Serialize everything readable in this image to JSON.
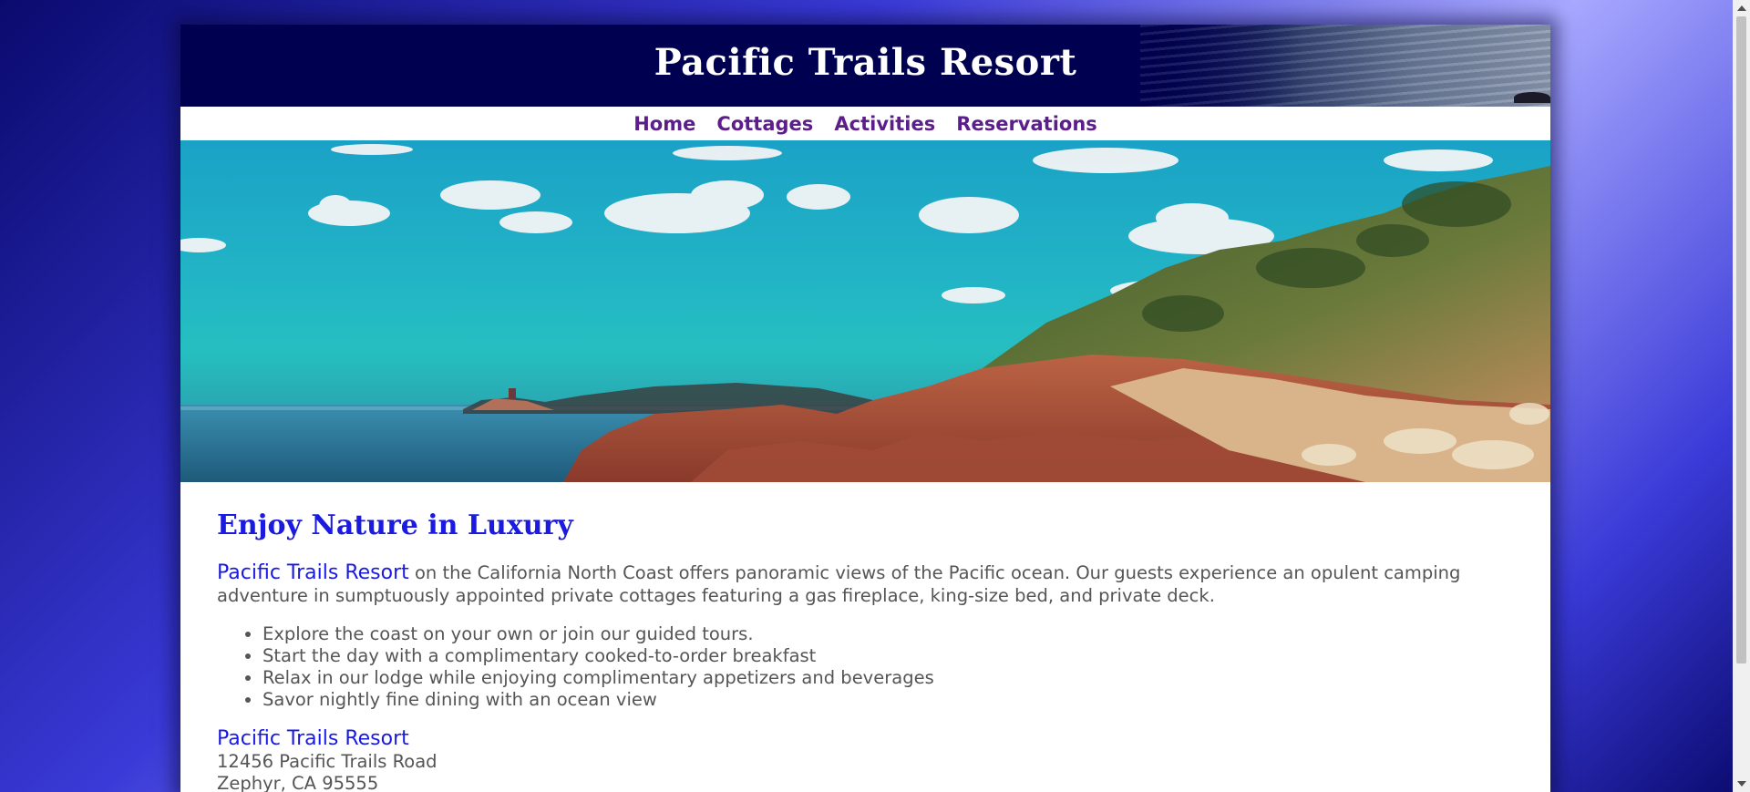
{
  "site": {
    "title": "Pacific Trails Resort"
  },
  "nav": {
    "items": [
      {
        "label": "Home"
      },
      {
        "label": "Cottages"
      },
      {
        "label": "Activities"
      },
      {
        "label": "Reservations"
      }
    ]
  },
  "main": {
    "heading": "Enjoy Nature in Luxury",
    "intro_name": "Pacific Trails Resort",
    "intro_text": " on the California North Coast offers panoramic views of the Pacific ocean. Our guests experience an opulent camping adventure in sumptuously appointed private cottages featuring a gas fireplace, king-size bed, and private deck.",
    "features": [
      "Explore the coast on your own or join our guided tours.",
      "Start the day with a complimentary cooked-to-order breakfast",
      "Relax in our lodge while enjoying complimentary appetizers and beverages",
      "Savor nightly fine dining with an ocean view"
    ],
    "address": {
      "name": "Pacific Trails Resort",
      "street": "12456 Pacific Trails Road",
      "city": "Zephyr, CA 95555"
    }
  },
  "colors": {
    "header_bg": "#000050",
    "nav_link": "#5c1e8a",
    "accent_blue": "#1a1ae0",
    "body_text": "#555555"
  },
  "icons": {
    "hero": "coastal-landscape-image",
    "header": "ocean-waves-image"
  }
}
